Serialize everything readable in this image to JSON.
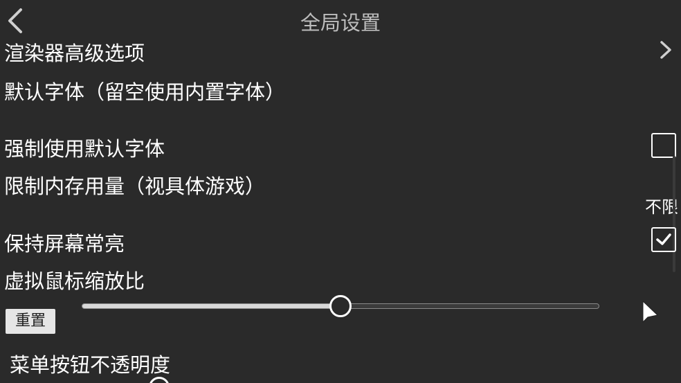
{
  "header": {
    "title": "全局设置",
    "back_icon": "chevron-left-icon"
  },
  "settings": {
    "renderer_advanced": "渲染器高级选项",
    "default_font": "默认字体（留空使用内置字体）",
    "force_default_font": "强制使用默认字体",
    "force_default_font_checked": false,
    "memory_limit": "限制内存用量（视具体游戏）",
    "memory_limit_value": "不限",
    "keep_screen_on": "保持屏幕常亮",
    "keep_screen_on_checked": true,
    "virtual_mouse_scale": "虚拟鼠标缩放比",
    "reset_label": "重置",
    "virtual_mouse_scale_value": 0.5,
    "menu_button_opacity": "菜单按钮不透明度"
  },
  "colors": {
    "background": "#2a2a2a",
    "text": "#ffffff",
    "title": "#bdbdbd"
  }
}
